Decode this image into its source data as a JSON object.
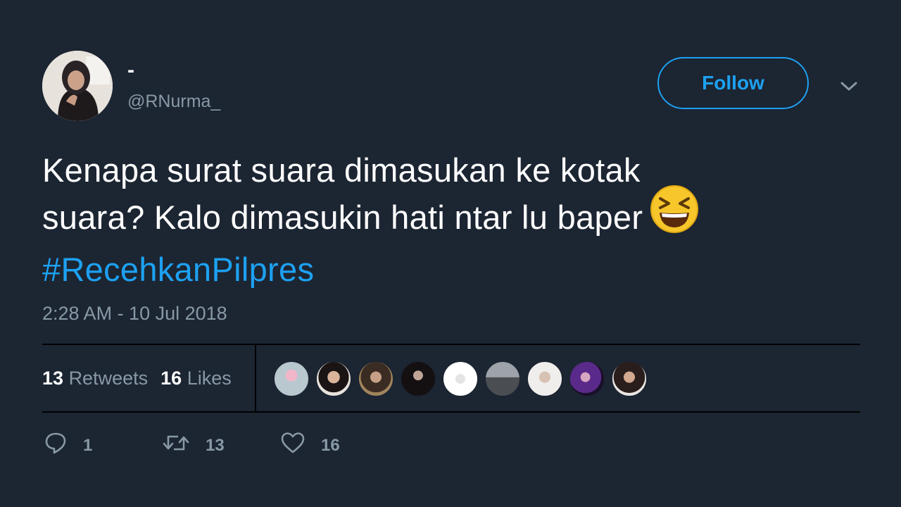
{
  "user": {
    "display_name": "-",
    "handle": "@RNurma_"
  },
  "follow_button": {
    "label": "Follow"
  },
  "tweet": {
    "line1": "Kenapa surat suara dimasukan ke kotak",
    "line2": "suara? Kalo dimasukin hati ntar lu baper",
    "hashtag": "#RecehkanPilpres",
    "emoji": "grinning-squinting-face",
    "timestamp": "2:28 AM - 10 Jul 2018"
  },
  "stats": {
    "retweets_count": "13",
    "retweets_label": "Retweets",
    "likes_count": "16",
    "likes_label": "Likes"
  },
  "actions": {
    "reply_count": "1",
    "retweet_count": "13",
    "like_count": "16"
  },
  "icons": [
    "chevron-down-icon",
    "reply-icon",
    "retweet-icon",
    "heart-icon"
  ],
  "colors": {
    "background": "#1c2532",
    "accent": "#1da1f2",
    "muted": "#8899a6"
  }
}
